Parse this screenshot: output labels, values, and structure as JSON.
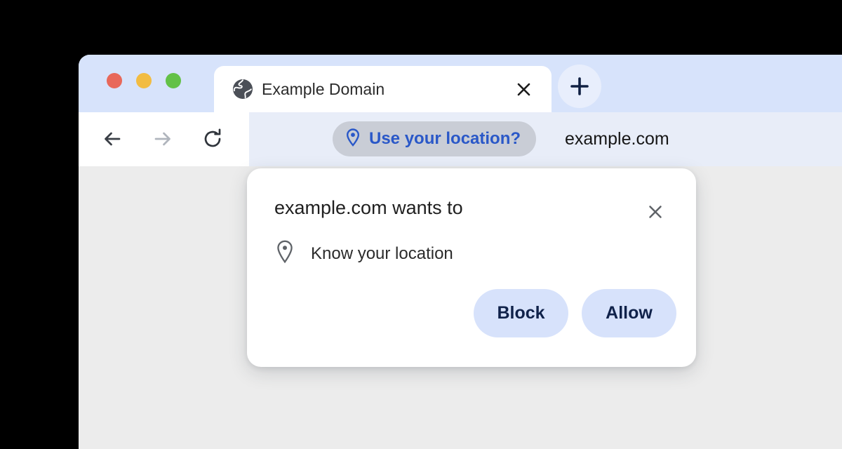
{
  "window": {
    "traffic_lights": [
      {
        "name": "close",
        "color": "#e8685a"
      },
      {
        "name": "minimize",
        "color": "#f2bc42"
      },
      {
        "name": "maximize",
        "color": "#63c147"
      }
    ]
  },
  "tabstrip": {
    "tabs": [
      {
        "title": "Example Domain",
        "favicon": "globe-icon",
        "close_label": "×"
      }
    ],
    "new_tab_label": "+"
  },
  "toolbar": {
    "back_icon": "arrow-left-icon",
    "forward_icon": "arrow-right-icon",
    "reload_icon": "reload-icon",
    "omnibox": {
      "chip": {
        "icon": "location-pin-icon",
        "label": "Use your location?",
        "text_color": "#2a58c8",
        "background": "#c9cdd6"
      },
      "url": "example.com"
    }
  },
  "permission_dialog": {
    "title": "example.com wants to",
    "close_label": "×",
    "request": {
      "icon": "location-pin-icon",
      "label": "Know your location"
    },
    "buttons": [
      {
        "name": "block",
        "label": "Block"
      },
      {
        "name": "allow",
        "label": "Allow"
      }
    ]
  },
  "colors": {
    "titlebar": "#d7e3fb",
    "toolbar": "#ffffff",
    "omnibox": "#e8edf8",
    "page_background": "#ececec",
    "dialog_background": "#ffffff",
    "button_background": "#d7e2fb",
    "button_text": "#10224a",
    "accent_blue": "#2a58c8"
  }
}
